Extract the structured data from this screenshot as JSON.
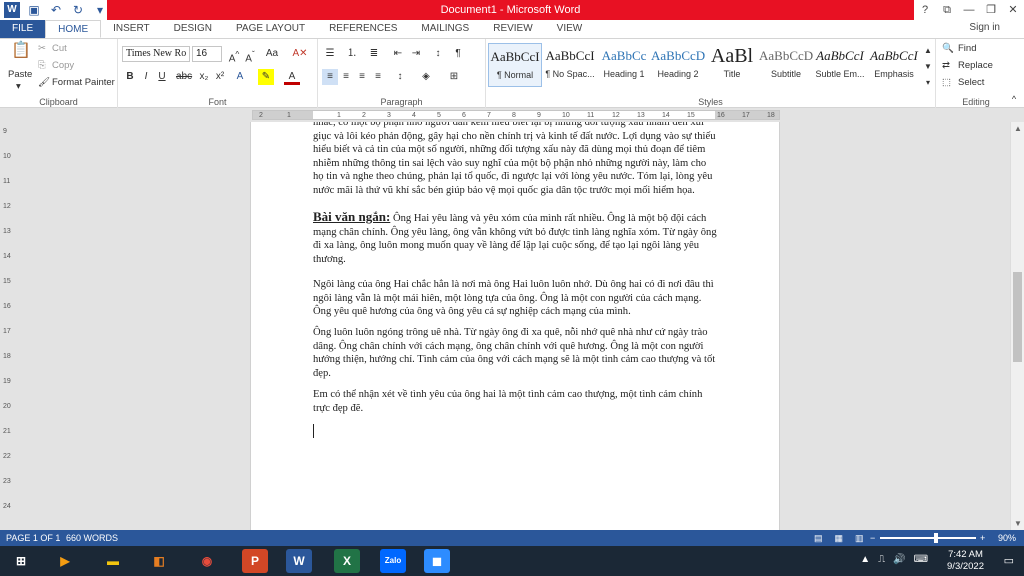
{
  "window": {
    "title": "Document1 - Microsoft Word",
    "controls": [
      "?",
      "⧉",
      "—",
      "❐",
      "✕"
    ]
  },
  "tabs": [
    "FILE",
    "HOME",
    "INSERT",
    "DESIGN",
    "PAGE LAYOUT",
    "REFERENCES",
    "MAILINGS",
    "REVIEW",
    "VIEW"
  ],
  "signin": "Sign in",
  "ribbon": {
    "clipboard": {
      "paste": "Paste",
      "cut": "Cut",
      "copy": "Copy",
      "format_painter": "Format Painter",
      "label": "Clipboard"
    },
    "font": {
      "name": "Times New Ro",
      "size": "16",
      "label": "Font"
    },
    "paragraph": {
      "label": "Paragraph"
    },
    "styles": {
      "label": "Styles",
      "items": [
        {
          "preview": "AaBbCcI",
          "name": "¶ Normal"
        },
        {
          "preview": "AaBbCcI",
          "name": "¶ No Spac..."
        },
        {
          "preview": "AaBbCc",
          "name": "Heading 1"
        },
        {
          "preview": "AaBbCcD",
          "name": "Heading 2"
        },
        {
          "preview": "AaBl",
          "name": "Title"
        },
        {
          "preview": "AaBbCcD",
          "name": "Subtitle"
        },
        {
          "preview": "AaBbCcI",
          "name": "Subtle Em..."
        },
        {
          "preview": "AaBbCcI",
          "name": "Emphasis"
        }
      ]
    },
    "editing": {
      "find": "Find",
      "replace": "Replace",
      "select": "Select",
      "label": "Editing"
    }
  },
  "ruler": {
    "h_ticks": [
      "2",
      "1",
      "1",
      "2",
      "3",
      "4",
      "5",
      "6",
      "7",
      "8",
      "9",
      "10",
      "11",
      "12",
      "13",
      "14",
      "15",
      "16",
      "17",
      "18"
    ],
    "v_ticks": [
      "9",
      "10",
      "11",
      "12",
      "13",
      "14",
      "15",
      "16",
      "17",
      "18",
      "19",
      "20",
      "21",
      "22",
      "23",
      "24"
    ]
  },
  "document": {
    "p0": "nhác, có một bộ phận nhỏ người dân kém hiểu biết lại bị những đối tượng xấu nhắm đến xúi giục và lôi kéo phản động, gây hại cho nền chính trị và kinh tế đất nước. Lợi dụng vào sự thiếu hiểu biết và cả tin của một số người, những đối tượng xấu này đã dùng mọi thủ đoạn để tiêm nhiễm những thông tin sai lệch vào suy nghĩ của một bộ phận nhỏ những người này, làm cho họ tin và nghe theo chúng, phản lại tổ quốc, đi ngược lại với lòng yêu nước. Tóm lại, lòng yêu nước mãi là thứ vũ khí sắc bén giúp bảo vệ mọi quốc gia dân tộc trước mọi mối hiểm họa.",
    "heading": "Bài văn ngắn:",
    "p1": " Ông Hai yêu làng và yêu xóm của mình rất nhiều. Ông là một bộ đội cách mạng chân chính. Ông yêu làng, ông vẫn không vứt bỏ được tình làng nghĩa xóm. Từ ngày ông đi xa làng, ông luôn mong muốn quay về làng để lập lại cuộc sống, để tạo lại ngôi làng yêu thương.",
    "p2": " Ngôi làng của ông Hai chắc hẳn là nơi mà ông Hai luôn luôn nhớ. Dù ông hai có đi nơi đâu thì ngôi làng vẫn là một mái hiên, một lòng tựa của ông. Ông là một con người của cách mạng. Ông yêu quê hương của ông và ông yêu cả sự nghiệp cách mạng của mình.",
    "p3": " Ông luôn luôn ngóng trông uê nhà. Từ ngày ông đi xa quê, nỗi nhớ quê nhà như cứ ngày trào dâng. Ông chân chính với cách mạng, ông chân chính với quê hương. Ông là một con người hướng thiện, hướng chỉ. Tình cảm của ông với cách mạng sẽ là một tình cảm cao thượng và tốt đẹp.",
    "p4": "  Em có thể nhận xét về tình yêu của ông hai là một tình cảm cao thượng, một tình cảm chính trực đẹp đẽ."
  },
  "status": {
    "page": "PAGE 1 OF 1",
    "words": "660 WORDS",
    "zoom": "90%",
    "zoom_level_percent": 90
  },
  "taskbar": {
    "apps": [
      "explorer",
      "media-player",
      "files",
      "store",
      "chrome",
      "powerpoint",
      "word",
      "excel",
      "zalo",
      "zoom"
    ],
    "time": "7:42 AM",
    "date": "9/3/2022"
  }
}
